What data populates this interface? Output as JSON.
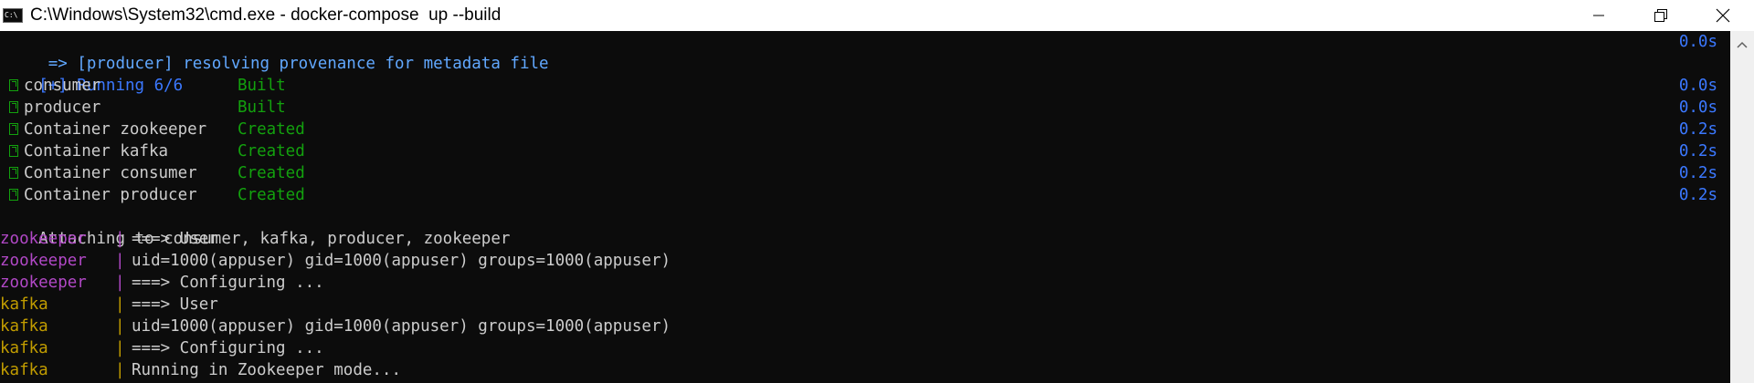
{
  "window": {
    "title": "C:\\Windows\\System32\\cmd.exe - docker-compose  up --build",
    "icon_text": "C:\\",
    "controls": {
      "minimize": "minimize-icon",
      "maximize": "restore-icon",
      "close": "close-icon"
    }
  },
  "colors": {
    "console_bg": "#0c0c0c",
    "build_step": "#61a8ff",
    "blue": "#3b78ff",
    "green": "#13a10e",
    "zookeeper": "#b148c6",
    "kafka": "#c19c00"
  },
  "console": {
    "build_line": {
      "text": " => [producer] resolving provenance for metadata file",
      "time": "0.0s"
    },
    "running_line": "[+] Running 6/6",
    "tasks": [
      {
        "name": "consumer",
        "status": "Built",
        "time": "0.0s"
      },
      {
        "name": "producer",
        "status": "Built",
        "time": "0.0s"
      },
      {
        "name": "Container zookeeper",
        "status": "Created",
        "time": "0.2s"
      },
      {
        "name": "Container kafka",
        "status": "Created",
        "time": "0.2s"
      },
      {
        "name": "Container consumer",
        "status": "Created",
        "time": "0.2s"
      },
      {
        "name": "Container producer",
        "status": "Created",
        "time": "0.2s"
      }
    ],
    "attaching_line": "Attaching to consumer, kafka, producer, zookeeper",
    "logs": [
      {
        "service": "zookeeper",
        "sep": "|",
        "message": "===> User"
      },
      {
        "service": "zookeeper",
        "sep": "|",
        "message": "uid=1000(appuser) gid=1000(appuser) groups=1000(appuser)"
      },
      {
        "service": "zookeeper",
        "sep": "|",
        "message": "===> Configuring ..."
      },
      {
        "service": "kafka",
        "sep": "|",
        "message": "===> User"
      },
      {
        "service": "kafka",
        "sep": "|",
        "message": "uid=1000(appuser) gid=1000(appuser) groups=1000(appuser)"
      },
      {
        "service": "kafka",
        "sep": "|",
        "message": "===> Configuring ..."
      },
      {
        "service": "kafka",
        "sep": "|",
        "message": "Running in Zookeeper mode..."
      }
    ]
  }
}
